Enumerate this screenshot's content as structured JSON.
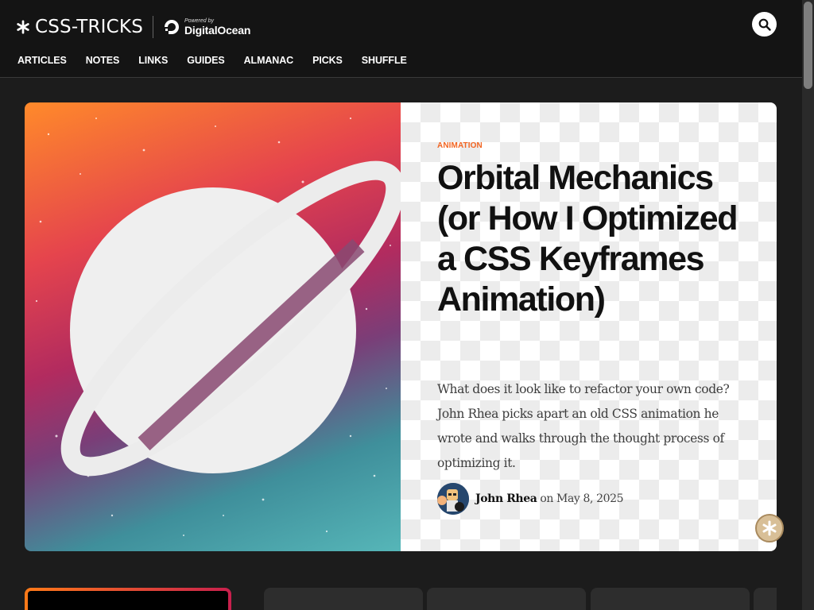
{
  "brand": {
    "name": "CSS-TRICKS",
    "powered_by": "Powered by",
    "sponsor": "DigitalOcean"
  },
  "nav": {
    "items": [
      "ARTICLES",
      "NOTES",
      "LINKS",
      "GUIDES",
      "ALMANAC",
      "PICKS",
      "SHUFFLE"
    ]
  },
  "hero": {
    "tag": "ANIMATION",
    "title": "Orbital Mechanics (or How I Optimized a CSS Keyframes Animation)",
    "excerpt": "What does it look like to refactor your own code? John Rhea picks apart an old CSS animation he wrote and walks through the thought process of optimizing it.",
    "author": "John Rhea",
    "on": "on",
    "date": "May 8, 2025"
  },
  "icons": {
    "search": "search-icon",
    "cookie": "cookie-icon",
    "logo": "asterisk-icon",
    "sponsor": "digitalocean-icon"
  },
  "colors": {
    "accent": "#f26522",
    "header_bg": "#141414",
    "page_bg": "#1c1c1c"
  }
}
